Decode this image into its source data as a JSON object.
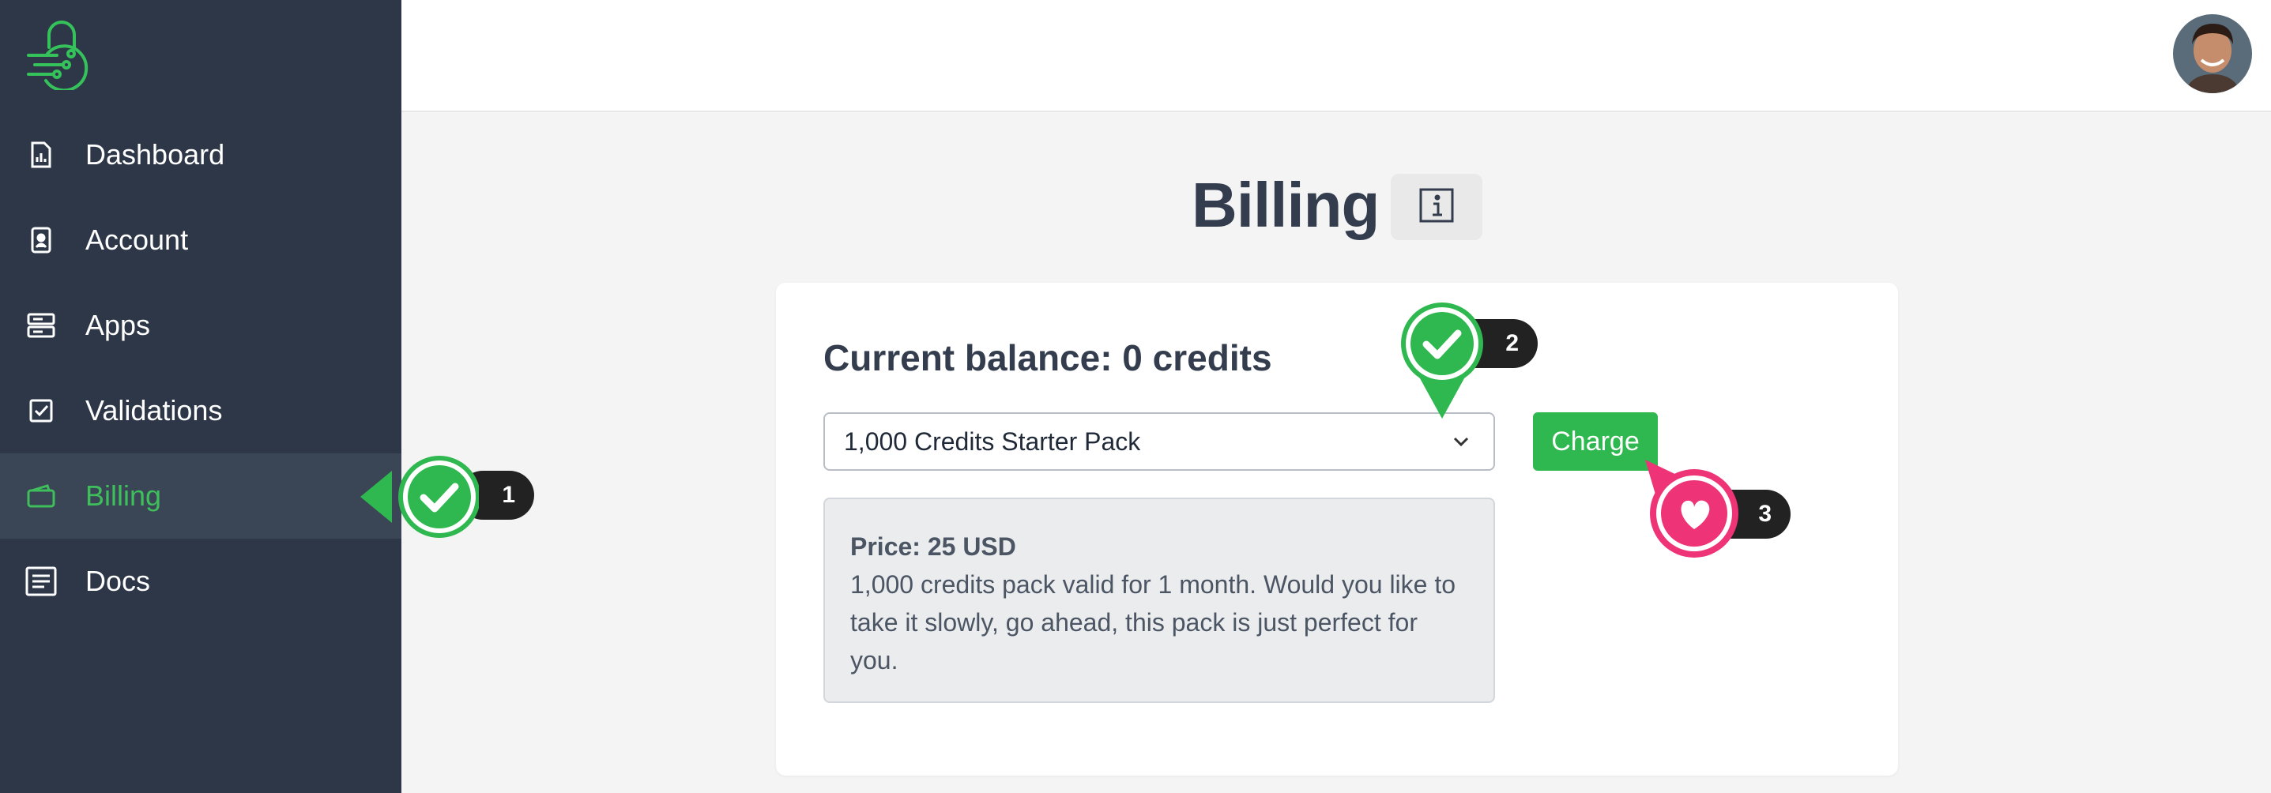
{
  "sidebar": {
    "logo_icon": "lock-circuit-icon",
    "items": [
      {
        "label": "Dashboard",
        "icon": "document-chart-icon"
      },
      {
        "label": "Account",
        "icon": "id-card-icon"
      },
      {
        "label": "Apps",
        "icon": "server-stack-icon"
      },
      {
        "label": "Validations",
        "icon": "checkbox-icon"
      },
      {
        "label": "Billing",
        "icon": "wallet-icon",
        "active": true
      },
      {
        "label": "Docs",
        "icon": "document-lines-icon"
      }
    ]
  },
  "header": {
    "avatar": "user-avatar"
  },
  "main": {
    "title": "Billing",
    "info_icon": "info-icon",
    "balance": "Current balance: 0 credits",
    "select_value": "1,000 Credits Starter Pack",
    "charge_label": "Charge",
    "price": "Price: 25 USD",
    "description": "1,000 credits pack valid for 1 month. Would you like to take it slowly, go ahead, this pack is just perfect for you."
  },
  "markers": [
    {
      "number": "1",
      "icon": "check-icon",
      "color": "#2fb84f"
    },
    {
      "number": "2",
      "icon": "check-icon",
      "color": "#2fb84f"
    },
    {
      "number": "3",
      "icon": "heart-icon",
      "color": "#ee3377"
    }
  ],
  "colors": {
    "sidebar": "#2d3748",
    "accent": "#2fb84f",
    "active_text": "#3fbf5b",
    "marker_pink": "#ee3377"
  }
}
